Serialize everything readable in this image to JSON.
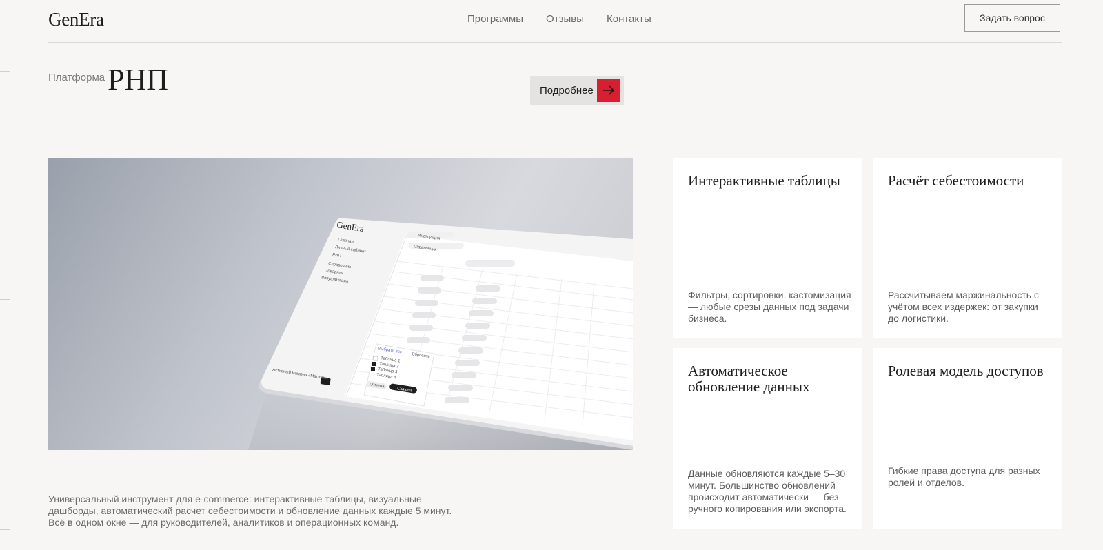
{
  "brand": {
    "logo": "GenEra"
  },
  "nav": {
    "items": [
      "Программы",
      "Отзывы",
      "Контакты"
    ]
  },
  "header": {
    "ask_button": "Задать вопрос"
  },
  "hero": {
    "label": "Платформа",
    "title": "РНП",
    "more_button": "Подробнее",
    "description": "Универсальный инструмент для e-commerce: интерактивные таблицы, визуальные дашборды, автоматический расчет себестоимости и обновление данных каждые 5 минут. Всё в одном окне — для руководителей, аналитиков и операционных команд."
  },
  "mockup": {
    "logo": "GenEra",
    "menu": [
      "Главная",
      "Личный кабинет",
      "РНП",
      "Справочник",
      "Товарная",
      "Визуализация"
    ],
    "tabs": [
      "Инструкция",
      "Справочник"
    ],
    "popup_title": "Выбрать все",
    "popup_reset": "Сбросить",
    "popup_items": [
      "Таблица 1",
      "Таблица 2",
      "Таблица 3",
      "Таблица 4"
    ],
    "popup_cancel": "Отмена",
    "popup_apply": "Скачать",
    "select_label": "Выбрать",
    "store_label": "Активный магазин «Магазин»"
  },
  "features": [
    {
      "title": "Интерактивные таблицы",
      "desc": "Фильтры, сортировки, кастомизация — любые срезы данных под задачи бизнеса."
    },
    {
      "title": "Расчёт себестоимости",
      "desc": "Рассчитываем маржинальность с учётом всех издержек: от закупки до логистики."
    },
    {
      "title": "Автоматическое обновление данных",
      "desc": "Данные обновляются каждые 5–30 минут. Большинство обновлений происходит автоматически — без ручного копирования или экспорта."
    },
    {
      "title": "Ролевая модель доступов",
      "desc": "Гибкие права доступа для разных ролей и отделов."
    }
  ]
}
